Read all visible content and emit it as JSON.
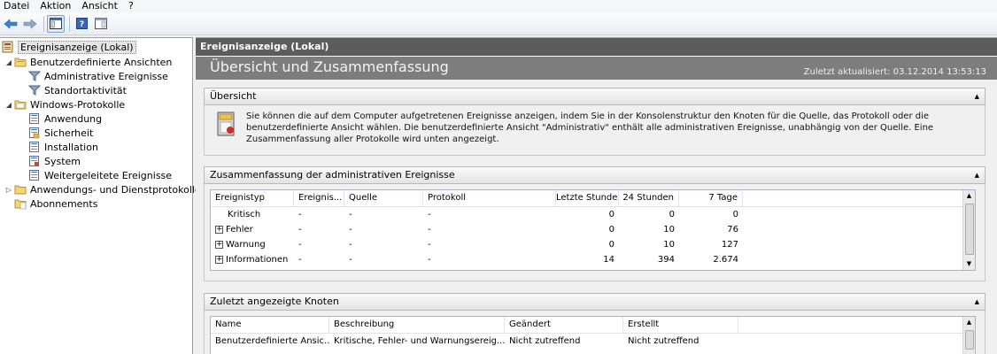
{
  "menu": [
    "Datei",
    "Aktion",
    "Ansicht",
    "?"
  ],
  "toolbar": {
    "buttons": [
      "back-icon",
      "forward-icon",
      "console-tree-icon",
      "help-icon",
      "show-action-pane-icon"
    ]
  },
  "tree": {
    "items": [
      {
        "label": "Ereignisanzeige (Lokal)",
        "icon": "event-viewer-icon",
        "expander": "",
        "selected": true
      },
      {
        "label": "Benutzerdefinierte Ansichten",
        "icon": "folder-icon",
        "expander": "◢"
      },
      {
        "label": "Administrative Ereignisse",
        "icon": "filter-icon",
        "expander": ""
      },
      {
        "label": "Standortaktivität",
        "icon": "filter-icon",
        "expander": ""
      },
      {
        "label": "Windows-Protokolle",
        "icon": "folder-icon",
        "expander": "◢"
      },
      {
        "label": "Anwendung",
        "icon": "log-icon",
        "expander": ""
      },
      {
        "label": "Sicherheit",
        "icon": "log-icon",
        "expander": ""
      },
      {
        "label": "Installation",
        "icon": "log-icon",
        "expander": ""
      },
      {
        "label": "System",
        "icon": "log-icon",
        "expander": ""
      },
      {
        "label": "Weitergeleitete Ereignisse",
        "icon": "log-icon",
        "expander": ""
      },
      {
        "label": "Anwendungs- und Dienstprotokolle",
        "icon": "folder-icon",
        "expander": "▷"
      },
      {
        "label": "Abonnements",
        "icon": "subscription-icon",
        "expander": ""
      }
    ]
  },
  "main": {
    "header": "Ereignisanzeige (Lokal)",
    "title": "Übersicht und Zusammenfassung",
    "updated": "Zuletzt aktualisiert: 03.12.2014 13:53:13",
    "overview": {
      "heading": "Übersicht",
      "text": "Sie können die auf dem Computer aufgetretenen Ereignisse anzeigen, indem Sie in der Konsolenstruktur den Knoten für die Quelle, das Protokoll oder die benutzerdefinierte Ansicht wählen. Die benutzerdefinierte Ansicht \"Administrativ\" enthält alle administrativen Ereignisse, unabhängig von der Quelle. Eine Zusammenfassung aller Protokolle wird unten angezeigt."
    },
    "summary": {
      "heading": "Zusammenfassung der administrativen Ereignisse",
      "columns": [
        "Ereignistyp",
        "Ereignis...",
        "Quelle",
        "Protokoll",
        "Letzte Stunde",
        "24 Stunden",
        "7 Tage"
      ],
      "rows": [
        {
          "type": "Kritisch",
          "expandable": false,
          "event": "-",
          "source": "-",
          "log": "-",
          "hour": "0",
          "day": "0",
          "week": "0"
        },
        {
          "type": "Fehler",
          "expandable": true,
          "event": "-",
          "source": "-",
          "log": "-",
          "hour": "0",
          "day": "10",
          "week": "76"
        },
        {
          "type": "Warnung",
          "expandable": true,
          "event": "-",
          "source": "-",
          "log": "-",
          "hour": "0",
          "day": "10",
          "week": "127"
        },
        {
          "type": "Informationen",
          "expandable": true,
          "event": "-",
          "source": "-",
          "log": "-",
          "hour": "14",
          "day": "394",
          "week": "2.674"
        }
      ]
    },
    "recent": {
      "heading": "Zuletzt angezeigte Knoten",
      "columns": [
        "Name",
        "Beschreibung",
        "Geändert",
        "Erstellt"
      ],
      "rows": [
        {
          "name": "Benutzerdefinierte Ansic...",
          "desc": "Kritische, Fehler- und Warnungsereig...",
          "changed": "Nicht zutreffend",
          "created": "Nicht zutreffend"
        }
      ]
    }
  }
}
